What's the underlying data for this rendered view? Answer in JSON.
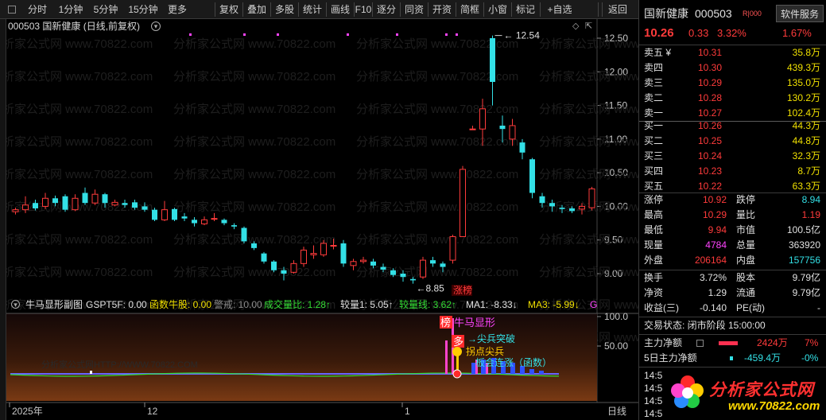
{
  "toolbar": {
    "left": [
      "分时",
      "1分钟",
      "5分钟",
      "15分钟",
      "更多"
    ],
    "right": [
      "复权",
      "叠加",
      "多股",
      "统计",
      "画线",
      "F10",
      "逐分",
      "同资",
      "开资",
      "简框",
      "小窗",
      "标记",
      "+自选",
      "返回"
    ]
  },
  "chart_title": "000503 国新健康 (日线,前复权)",
  "price_axis": [
    "12.50",
    "12.00",
    "11.50",
    "11.00",
    "10.50",
    "10.00",
    "9.50",
    "9.00"
  ],
  "markers": {
    "high": "12.54",
    "low": "8.85",
    "limit_up": "涨榜"
  },
  "indicator_bar": [
    {
      "text": "牛马显形副图",
      "color": "#e0e0e0"
    },
    {
      "text": "GSPT5F: 0.00",
      "color": "#e0e0e0"
    },
    {
      "text": "函数牛股: 0.00",
      "color": "#f0e000"
    },
    {
      "text": "警戒: 10.00",
      "color": "#888888"
    },
    {
      "text": "成交量比: 1.28↑",
      "color": "#33dd33"
    },
    {
      "text": "较量1: 5.05↑",
      "color": "#e0e0e0"
    },
    {
      "text": "较量线: 3.62↑",
      "color": "#33dd33"
    },
    {
      "text": "MA1: -8.33↓",
      "color": "#e0e0e0"
    },
    {
      "text": "MA3: -5.99↓",
      "color": "#f0e000"
    },
    {
      "text": "G",
      "color": "#ff44ff"
    }
  ],
  "sub_axis": [
    "100.0",
    "50.00"
  ],
  "sub_labels": {
    "bang": "榜",
    "niuma": "牛马显形",
    "duo": "多",
    "jianbing": "尖兵突破",
    "jiandian": "拐点尖兵",
    "bankuai": "板会连涨（函数）",
    "watermark_url": "分析家公式网HTTP://WWW.70822.COM"
  },
  "time_axis": {
    "labels": [
      "2025年",
      "12",
      "1"
    ],
    "mode": "日线"
  },
  "watermark": "分析家公式网 www.70822.com",
  "stock": {
    "name": "国新健康",
    "code": "000503",
    "tag": "R|000",
    "service": "软件服务",
    "price": "10.26",
    "change": "0.33",
    "pct": "3.32%",
    "service_pct": "1.67%"
  },
  "asks": [
    {
      "label": "卖五 ¥",
      "price": "10.31",
      "vol": "35.8万"
    },
    {
      "label": "卖四",
      "price": "10.30",
      "vol": "439.3万"
    },
    {
      "label": "卖三",
      "price": "10.29",
      "vol": "135.0万"
    },
    {
      "label": "卖二",
      "price": "10.28",
      "vol": "130.2万"
    },
    {
      "label": "卖一",
      "price": "10.27",
      "vol": "102.4万"
    }
  ],
  "bids": [
    {
      "label": "买一",
      "price": "10.26",
      "vol": "44.3万"
    },
    {
      "label": "买二",
      "price": "10.25",
      "vol": "44.8万"
    },
    {
      "label": "买三",
      "price": "10.24",
      "vol": "32.3万"
    },
    {
      "label": "买四",
      "price": "10.23",
      "vol": "8.7万"
    },
    {
      "label": "买五",
      "price": "10.22",
      "vol": "63.3万"
    }
  ],
  "stats": [
    {
      "l1": "涨停",
      "v1": "10.92",
      "c1": "red",
      "l2": "跌停",
      "v2": "8.94",
      "c2": "grn"
    },
    {
      "l1": "最高",
      "v1": "10.29",
      "c1": "red",
      "l2": "量比",
      "v2": "1.19",
      "c2": "red"
    },
    {
      "l1": "最低",
      "v1": "9.94",
      "c1": "red",
      "l2": "市值",
      "v2": "100.5亿",
      "c2": "wht"
    },
    {
      "l1": "现量",
      "v1": "4784",
      "c1": "mag",
      "l2": "总量",
      "v2": "363920",
      "c2": "wht"
    },
    {
      "l1": "外盘",
      "v1": "206164",
      "c1": "red",
      "l2": "内盘",
      "v2": "157756",
      "c2": "grn"
    }
  ],
  "stats2": [
    {
      "l1": "换手",
      "v1": "3.72%",
      "l2": "股本",
      "v2": "9.79亿"
    },
    {
      "l1": "净资",
      "v1": "1.29",
      "l2": "流通",
      "v2": "9.79亿"
    },
    {
      "l1": "收益(三)",
      "v1": "-0.140",
      "l2": "PE(动)",
      "v2": "-"
    }
  ],
  "trade_status": "交易状态: 闭市阶段 15:00:00",
  "main_flow": {
    "label": "主力净额",
    "value": "2424万",
    "pct": "7%"
  },
  "main_flow5": {
    "label": "5日主力净额",
    "value": "-459.4万",
    "pct": "-0%"
  },
  "ticks": [
    "14:5",
    "14:5",
    "14:5",
    "14:5"
  ],
  "logo": {
    "text": "分析家公式网",
    "url": "www.70822.com"
  }
}
